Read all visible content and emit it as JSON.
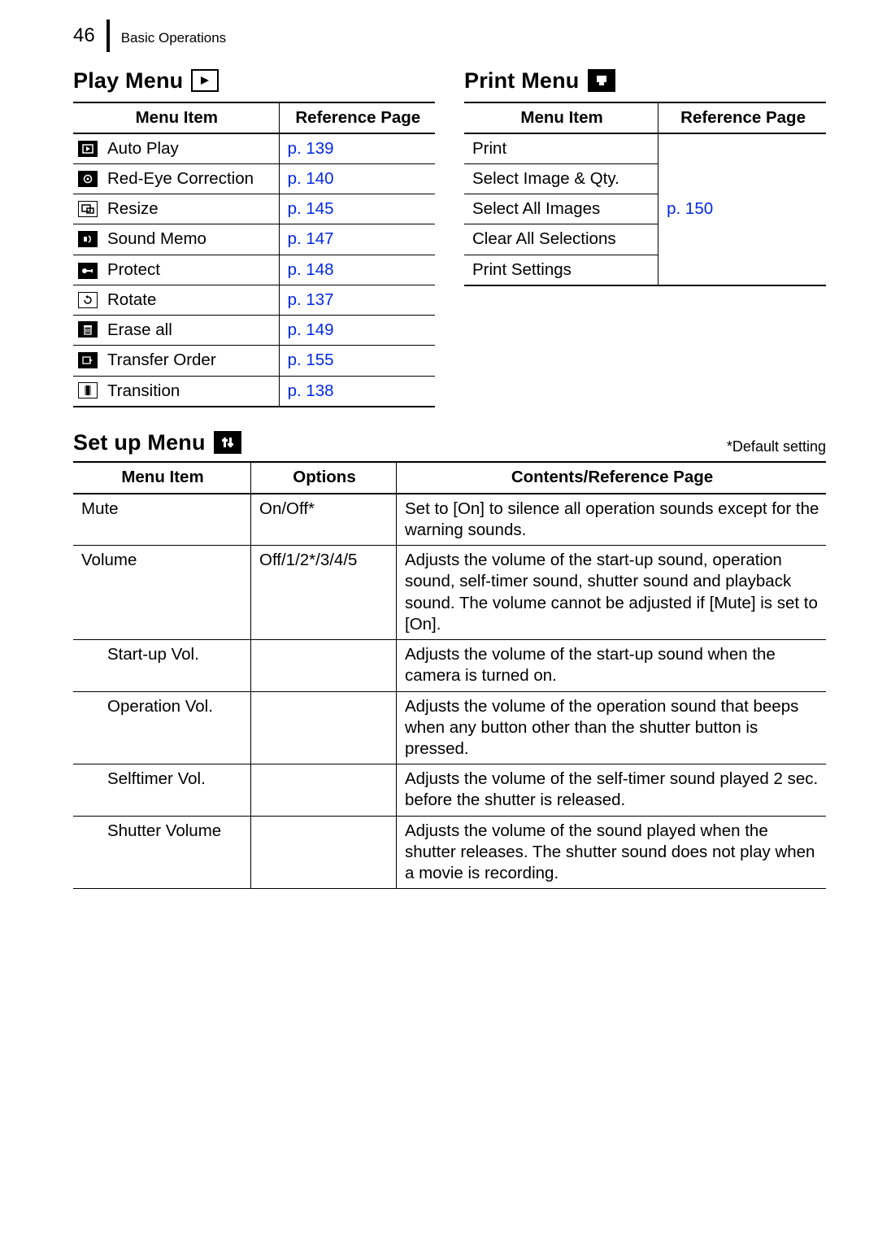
{
  "header": {
    "page_number": "46",
    "section": "Basic Operations"
  },
  "play_menu": {
    "title": "Play Menu",
    "icon": "play-icon",
    "headers": {
      "item": "Menu Item",
      "ref": "Reference Page"
    },
    "rows": [
      {
        "icon": "autoplay-icon",
        "name": "Auto Play",
        "ref": "p. 139"
      },
      {
        "icon": "redeye-icon",
        "name": "Red-Eye Correction",
        "ref": "p. 140"
      },
      {
        "icon": "resize-icon",
        "name": "Resize",
        "ref": "p. 145"
      },
      {
        "icon": "soundmemo-icon",
        "name": "Sound Memo",
        "ref": "p. 147"
      },
      {
        "icon": "protect-icon",
        "name": "Protect",
        "ref": "p. 148"
      },
      {
        "icon": "rotate-icon",
        "name": "Rotate",
        "ref": "p. 137"
      },
      {
        "icon": "erase-icon",
        "name": "Erase all",
        "ref": "p. 149"
      },
      {
        "icon": "transfer-icon",
        "name": "Transfer Order",
        "ref": "p. 155"
      },
      {
        "icon": "transition-icon",
        "name": "Transition",
        "ref": "p. 138"
      }
    ]
  },
  "print_menu": {
    "title": "Print Menu",
    "icon": "print-icon",
    "headers": {
      "item": "Menu Item",
      "ref": "Reference Page"
    },
    "rows": [
      {
        "name": "Print"
      },
      {
        "name": "Select Image & Qty."
      },
      {
        "name": "Select All Images"
      },
      {
        "name": "Clear All Selections"
      },
      {
        "name": "Print Settings"
      }
    ],
    "ref": "p. 150"
  },
  "setup_menu": {
    "title": "Set up Menu",
    "icon": "setup-icon",
    "footnote": "*Default setting",
    "headers": {
      "item": "Menu Item",
      "options": "Options",
      "contents": "Contents/Reference Page"
    },
    "rows": [
      {
        "name": "Mute",
        "indent": false,
        "options": "On/Off*",
        "contents": "Set to [On] to silence all operation sounds except for the warning sounds."
      },
      {
        "name": "Volume",
        "indent": false,
        "options": "Off/1/2*/3/4/5",
        "contents": "Adjusts the volume of the start-up sound, operation sound, self-timer sound, shutter sound and playback sound. The volume cannot be adjusted if [Mute] is set to [On]."
      },
      {
        "name": "Start-up Vol.",
        "indent": true,
        "options": "",
        "contents": "Adjusts the volume of the start-up sound when the camera is turned on."
      },
      {
        "name": "Operation Vol.",
        "indent": true,
        "options": "",
        "contents": "Adjusts the volume of the operation sound that beeps when any button other than the shutter button is pressed."
      },
      {
        "name": "Selftimer Vol.",
        "indent": true,
        "options": "",
        "contents": "Adjusts the volume of the self-timer sound played 2 sec. before the shutter is released."
      },
      {
        "name": "Shutter Volume",
        "indent": true,
        "options": "",
        "contents": "Adjusts the volume of the sound played when the shutter releases. The shutter sound does not play when a movie is recording."
      }
    ]
  }
}
